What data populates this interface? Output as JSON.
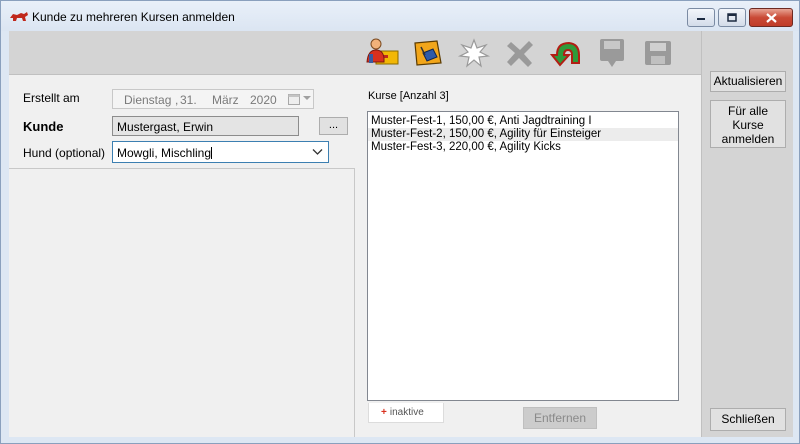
{
  "window": {
    "title": "Kunde zu mehreren Kursen anmelden"
  },
  "toolbar": {
    "icons": [
      "user-card-icon",
      "edit-note-icon",
      "burst-icon",
      "cross-arrow-icon",
      "undo-arrow-icon",
      "save-down-icon",
      "save-icon"
    ]
  },
  "form": {
    "erstellt_label": "Erstellt am",
    "date": {
      "weekday": "Dienstag",
      "comma": ",",
      "day": "31.",
      "month": "März",
      "year": "2020"
    },
    "kunde_label": "Kunde",
    "kunde_value": "Mustergast, Erwin",
    "browse_label": "...",
    "hund_label": "Hund (optional)",
    "hund_value": "Mowgli, Mischling"
  },
  "kurse": {
    "header": "Kurse [Anzahl 3]",
    "items": [
      "Muster-Fest-1, 150,00 €, Anti Jagdtraining I",
      "Muster-Fest-2, 150,00 €, Agility für Einsteiger",
      "Muster-Fest-3, 220,00 €, Agility Kicks"
    ],
    "inaktive_plus": "+",
    "inaktive_label": "inaktive",
    "entfernen_label": "Entfernen"
  },
  "sidebar": {
    "aktualisieren": "Aktualisieren",
    "fuer_alle_line1": "Für alle",
    "fuer_alle_line2": "Kurse",
    "fuer_alle_line3": "anmelden",
    "schliessen": "Schließen"
  },
  "colors": {
    "window_frame": "#dde7f3",
    "client_bg": "#f0f0f0",
    "toolbar_bg": "#d4d4d4",
    "close_red": "#c94a36",
    "combo_border": "#3c7fb1",
    "inactive_plus": "#d9301e"
  }
}
